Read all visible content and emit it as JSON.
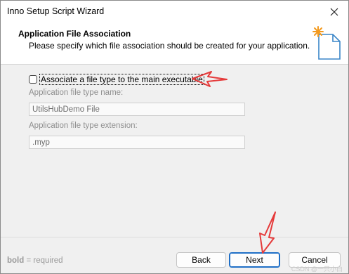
{
  "window": {
    "title": "Inno Setup Script Wizard"
  },
  "header": {
    "title": "Application File Association",
    "subtitle": "Please specify which file association should be created for your application."
  },
  "form": {
    "checkbox_label": "Associate a file type to the main executable",
    "checkbox_checked": false,
    "type_name_label": "Application file type name:",
    "type_name_value": "UtilsHubDemo File",
    "extension_label": "Application file type extension:",
    "extension_value": ".myp"
  },
  "footer": {
    "legend_bold": "bold",
    "legend_rest": " = required",
    "back_label": "Back",
    "next_label": "Next",
    "cancel_label": "Cancel",
    "watermark": "CSDN @一只小白"
  },
  "colors": {
    "annotation_arrow": "#e53a3a",
    "default_button_border": "#1f6fc7"
  },
  "icons": {
    "close": "close-icon",
    "wizard": "wizard-file-icon"
  }
}
